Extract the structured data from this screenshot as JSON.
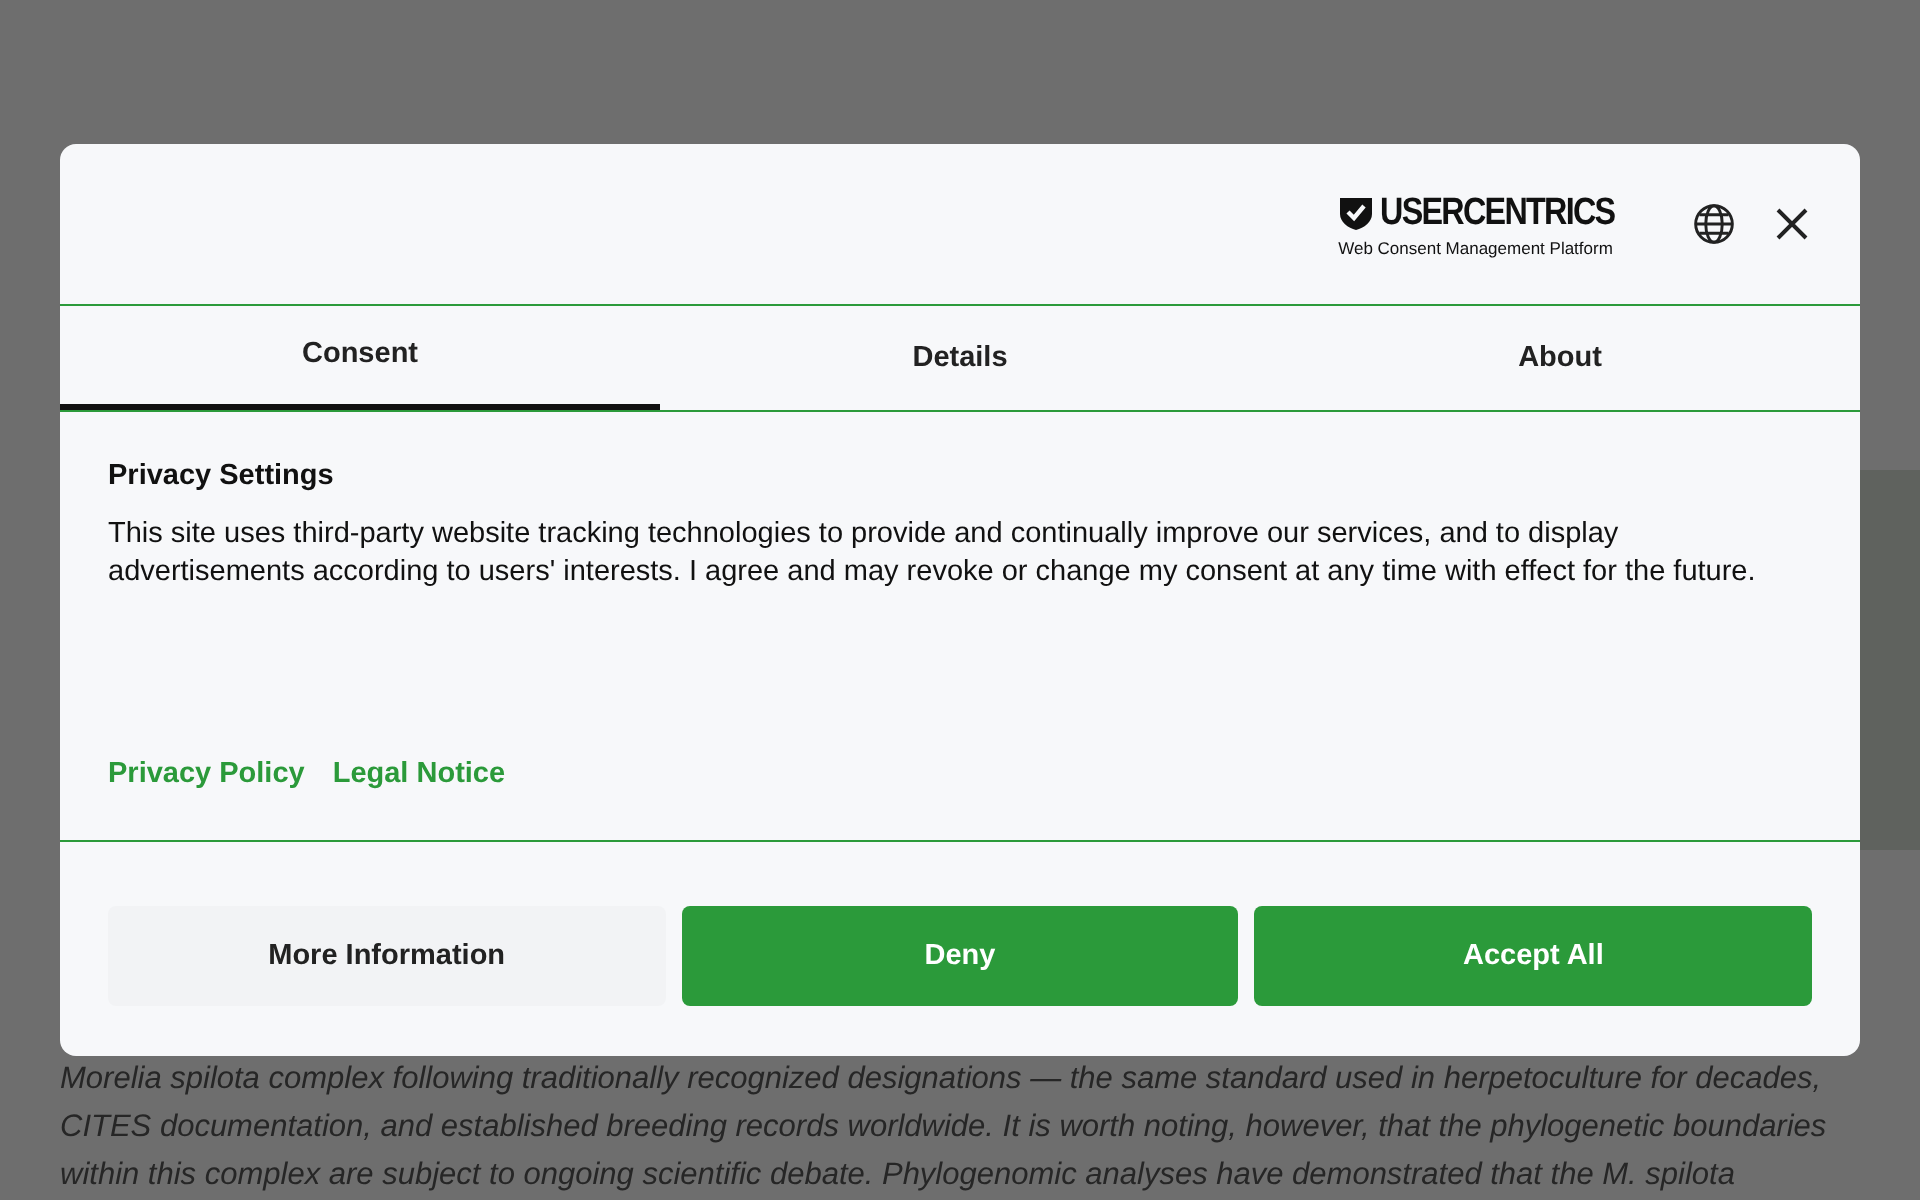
{
  "background_article": {
    "paragraph": "Morelia spilota complex following traditionally recognized designations — the same standard used in herpetoculture for decades, CITES documentation, and established breeding records worldwide. It is worth noting, however, that the phylogenetic boundaries within this complex are subject to ongoing scientific debate. Phylogenomic analyses have demonstrated that the M. spilota"
  },
  "dialog": {
    "brand": {
      "name": "USERCENTRICS",
      "tagline": "Web Consent Management Platform"
    },
    "tabs": [
      {
        "label": "Consent",
        "selected": true
      },
      {
        "label": "Details",
        "selected": false
      },
      {
        "label": "About",
        "selected": false
      }
    ],
    "title": "Privacy Settings",
    "body": "This site uses third-party website tracking technologies to provide and continually improve our services, and to display advertisements according to users' interests. I agree and may revoke or change my consent at any time with effect for the future.",
    "links": [
      "Privacy Policy",
      "Legal Notice"
    ],
    "buttons": [
      {
        "label": "More Information",
        "kind": "secondary"
      },
      {
        "label": "Deny",
        "kind": "primary"
      },
      {
        "label": "Accept All",
        "kind": "primary"
      }
    ]
  }
}
